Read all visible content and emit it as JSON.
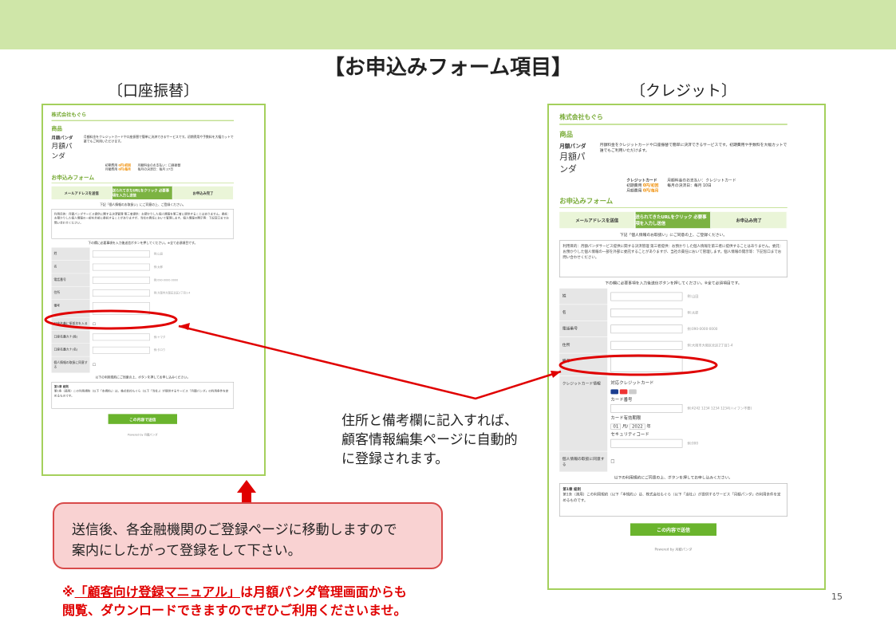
{
  "slide": {
    "title": "【お申込みフォーム項目】",
    "left_label": "〔口座振替〕",
    "right_label": "〔クレジット〕",
    "callout_lines": [
      "住所と備考欄に記入すれば、",
      "顧客情報編集ページに自動的",
      "に登録されます。"
    ],
    "info_lines": [
      "送信後、各金融機関のご登録ページに移動しますので",
      "案内にしたがって登録をして下さい。"
    ],
    "warn_prefix": "※",
    "warn_link": "「顧客向け登録マニュアル」",
    "warn_rest": "は月額パンダ管理画面からも",
    "warn_line2": "閲覧、ダウンロードできますのでぜひご利用くださいませ。",
    "page_number": "15"
  },
  "form_left": {
    "company": "株式会社もぐら",
    "product_heading": "商品",
    "product_label": "月額パンダ",
    "product_name": "月額パンダ",
    "product_desc": "月額料金をクレジットカードや口座振替で簡単に決済できるサービスです。初期費用や手数料を大幅カットで誰でもご利用いただけます。",
    "plan_rows": [
      {
        "label": "初期費用",
        "price": "0円/初回"
      },
      {
        "label": "月額費用",
        "price": "0円/毎月"
      }
    ],
    "plan_notes": [
      "月額料金のお支払い：口座振替",
      "毎月の決済日：毎月 27日"
    ],
    "form_heading": "お申込みフォーム",
    "steps": [
      "メールアドレスを送信",
      "送られてきたURLをクリック 必要事項を入力し送信",
      "お申込み完了"
    ],
    "note": "下記「個人情報のお取扱い」にご同意の上、ご登録ください。",
    "terms": "利用目的：月額パンダサービス提供に関する決済管理 第三者提供：お預かりした個人情報を第三者に提供することはありません。委託：お預かりした個人情報の一部を外部に委託することがありますが、当社の責任において管理します。個人情報の開示等：下記窓口までお問い合わせください。",
    "required_note": "下の欄に必要事項を入力後送信ボタンを押してください。※全て必須項目です。",
    "fields": [
      {
        "label": "姓",
        "hint": "例:山田"
      },
      {
        "label": "名",
        "hint": "例:太郎"
      },
      {
        "label": "電話番号",
        "hint": "例:090-0000-0000"
      },
      {
        "label": "住所",
        "hint": "例:大阪市大阪区北区2丁目1-4"
      },
      {
        "label": "備考",
        "hint": ""
      },
      {
        "label": "口座名義に振仮名を入る",
        "hint": ""
      },
      {
        "label": "口座名義カナ(姓)",
        "hint": "例:ヤマダ"
      },
      {
        "label": "口座名義カナ(名)",
        "hint": "例:タロウ"
      },
      {
        "label": "個人情報の取扱に同意する",
        "hint": ""
      }
    ],
    "agree_note": "以下の利用規約にご同意の上、ボタンを押してお申し込みください。",
    "rules_title": "第1章 総則",
    "rules_text": "第1条（適用）この利用規約（以下「本規約」）は、株式会社もぐら（以下「当社」）が提供するサービス「月額パンダ」の利用条件を定めるものです。",
    "submit_label": "この内容で送信",
    "footer": "Powered by 月額パンダ"
  },
  "form_right": {
    "company": "株式会社もぐら",
    "product_heading": "商品",
    "product_label": "月額パンダ",
    "product_name": "月額パンダ",
    "product_desc": "月額料金をクレジットカードや口座振替で簡単に決済できるサービスです。初期費用や手数料を大幅カットで誰でもご利用いただけます。",
    "plan_title": "クレジットカード",
    "plan_rows": [
      {
        "label": "初期費用",
        "price": "0円/初回"
      },
      {
        "label": "月額費用",
        "price": "0円/毎月"
      }
    ],
    "plan_notes": [
      "月額料金のお支払い：クレジットカード",
      "毎月の決済日：毎月 10日"
    ],
    "form_heading": "お申込みフォーム",
    "steps": [
      "メールアドレスを送信",
      "送られてきたURLをクリック 必要事項を入力し送信",
      "お申込み完了"
    ],
    "note": "下記「個人情報のお取扱い」にご同意の上、ご登録ください。",
    "terms": "利用目的：月額パンダサービス提供に関する決済管理 第三者提供：お預かりした個人情報を第三者に提供することはありません。委託：お預かりした個人情報の一部を外部に委託することがありますが、当社の責任において管理します。個人情報の開示等：下記窓口までお問い合わせください。",
    "required_note": "下の欄に必要事項を入力後送信ボタンを押してください。※全て必須項目です。",
    "fields": [
      {
        "label": "姓",
        "hint": "例:山田"
      },
      {
        "label": "名",
        "hint": "例:太郎"
      },
      {
        "label": "電話番号",
        "hint": "例:090-0000-0000"
      },
      {
        "label": "住所",
        "hint": "例:大阪市大阪区北区2丁目1-4"
      },
      {
        "label": "備考",
        "hint": ""
      }
    ],
    "card_label": "クレジットカード情報",
    "card_accepted": "対応クレジットカード",
    "card_number_label": "カード番号",
    "card_number_hint": "例:4242 1234 1234 1234(ハイフン不要)",
    "expiry_label": "カード有効期限",
    "expiry_month": "01",
    "expiry_year": "2022",
    "month_unit": "月/",
    "year_unit": "年",
    "security_label": "セキュリティコード",
    "security_hint": "例:000",
    "agree_label": "個人情報の取扱に同意する",
    "agree_note": "以下の利用規約にご同意の上、ボタンを押してお申し込みください。",
    "rules_title": "第1章 総則",
    "rules_text": "第1条（適用）この利用規約（以下「本規約」）は、株式会社もぐら（以下「当社」）が提供するサービス「月額パンダ」の利用条件を定めるものです。",
    "submit_label": "この内容で送信",
    "footer": "Powered by 月額パンダ"
  },
  "colors": {
    "accent_green": "#7cb342",
    "highlight_red": "#e00000",
    "info_box_fill": "#f9d2d2"
  }
}
